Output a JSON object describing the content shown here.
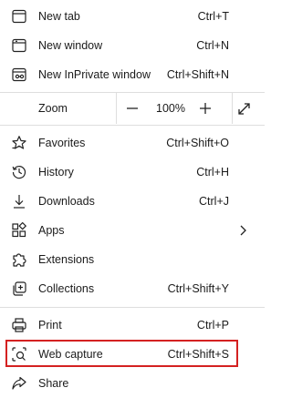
{
  "menu": {
    "new_tab": {
      "label": "New tab",
      "shortcut": "Ctrl+T",
      "icon": "new-tab-icon"
    },
    "new_window": {
      "label": "New window",
      "shortcut": "Ctrl+N",
      "icon": "new-window-icon"
    },
    "new_inprivate": {
      "label": "New InPrivate window",
      "shortcut": "Ctrl+Shift+N",
      "icon": "inprivate-icon"
    },
    "zoom": {
      "label": "Zoom",
      "value": "100%",
      "decrease": "−",
      "increase": "+"
    },
    "favorites": {
      "label": "Favorites",
      "shortcut": "Ctrl+Shift+O",
      "icon": "star-icon"
    },
    "history": {
      "label": "History",
      "shortcut": "Ctrl+H",
      "icon": "history-icon"
    },
    "downloads": {
      "label": "Downloads",
      "shortcut": "Ctrl+J",
      "icon": "download-icon"
    },
    "apps": {
      "label": "Apps",
      "icon": "apps-icon"
    },
    "extensions": {
      "label": "Extensions",
      "icon": "puzzle-icon"
    },
    "collections": {
      "label": "Collections",
      "shortcut": "Ctrl+Shift+Y",
      "icon": "collections-icon"
    },
    "print": {
      "label": "Print",
      "shortcut": "Ctrl+P",
      "icon": "printer-icon"
    },
    "web_capture": {
      "label": "Web capture",
      "shortcut": "Ctrl+Shift+S",
      "icon": "web-capture-icon"
    },
    "share": {
      "label": "Share",
      "icon": "share-icon"
    }
  },
  "colors": {
    "highlight_border": "#d42121",
    "divider": "#dedede",
    "text": "#1b1b1b"
  }
}
